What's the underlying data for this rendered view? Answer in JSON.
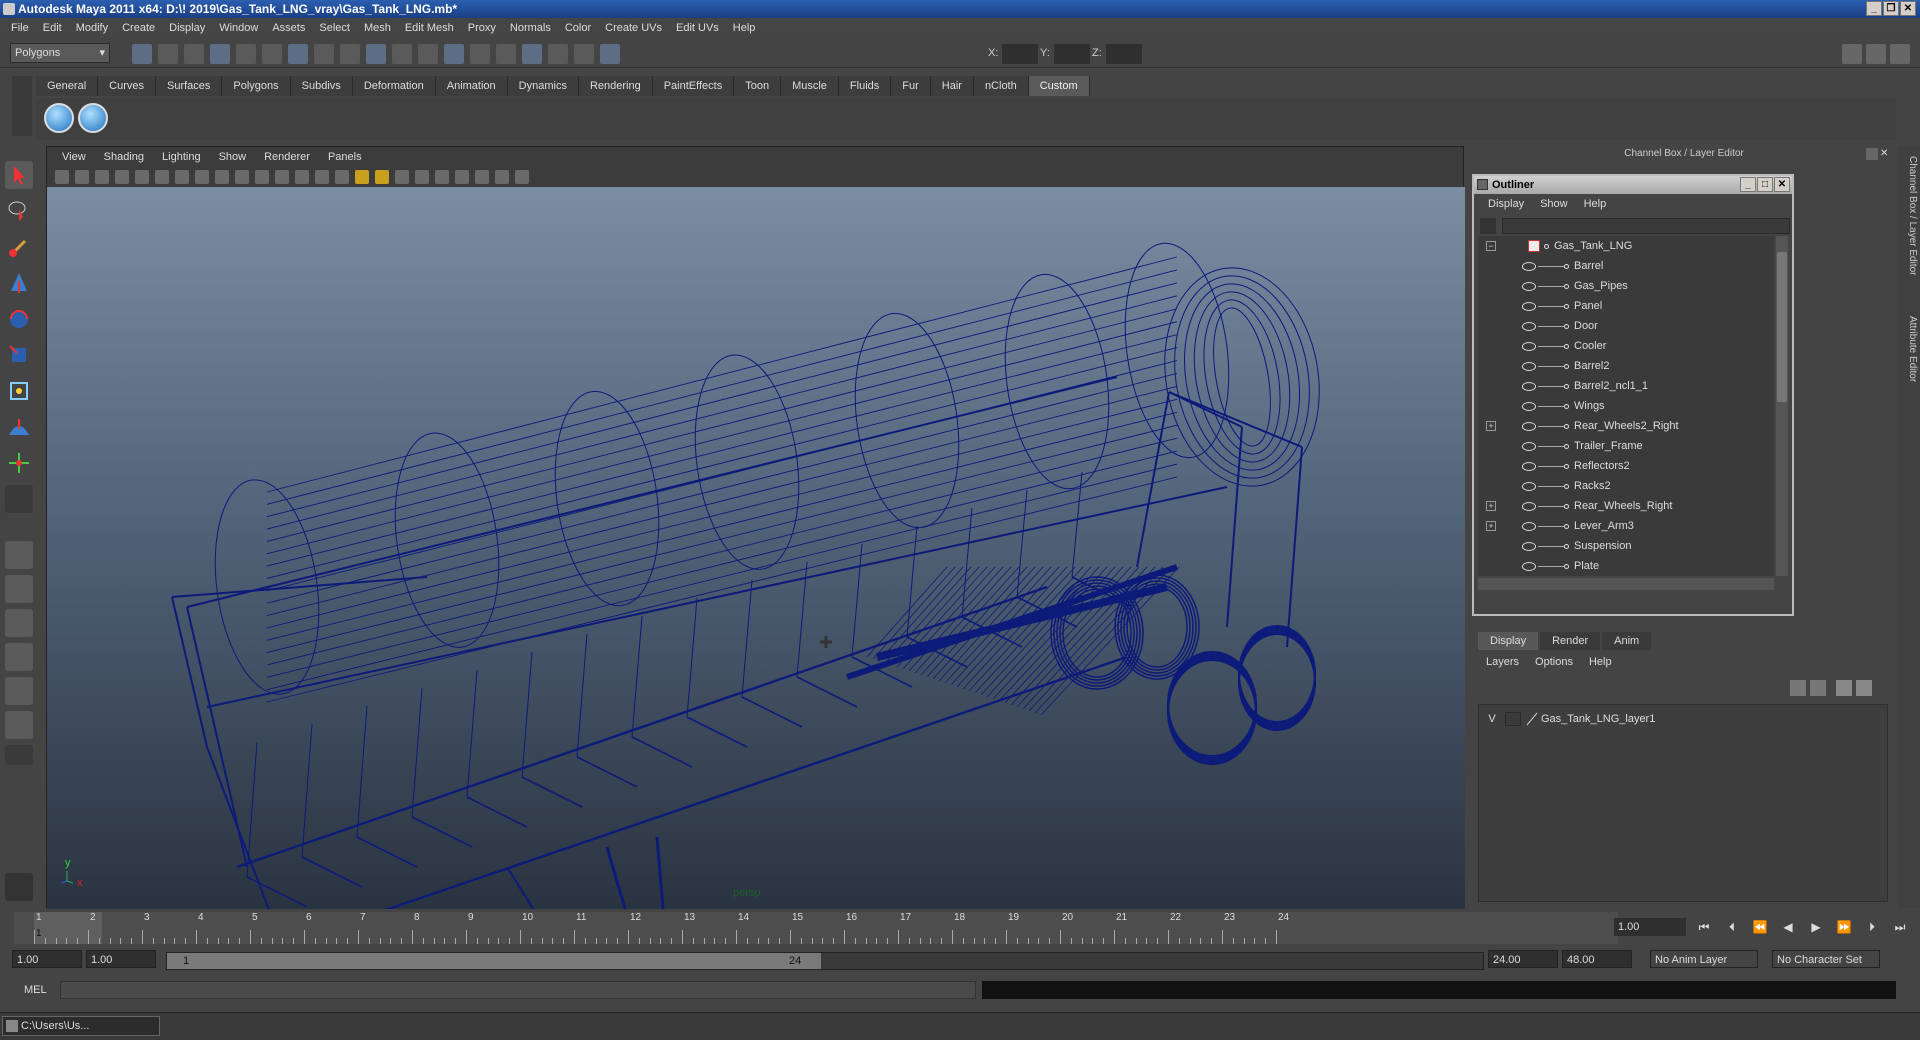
{
  "window": {
    "title": "Autodesk Maya 2011 x64: D:\\! 2019\\Gas_Tank_LNG_vray\\Gas_Tank_LNG.mb*"
  },
  "menubar": [
    "File",
    "Edit",
    "Modify",
    "Create",
    "Display",
    "Window",
    "Assets",
    "Select",
    "Mesh",
    "Edit Mesh",
    "Proxy",
    "Normals",
    "Color",
    "Create UVs",
    "Edit UVs",
    "Help"
  ],
  "statusline": {
    "mode_select": "Polygons",
    "x_label": "X:",
    "y_label": "Y:",
    "z_label": "Z:"
  },
  "shelf_tabs": [
    "General",
    "Curves",
    "Surfaces",
    "Polygons",
    "Subdivs",
    "Deformation",
    "Animation",
    "Dynamics",
    "Rendering",
    "PaintEffects",
    "Toon",
    "Muscle",
    "Fluids",
    "Fur",
    "Hair",
    "nCloth",
    "Custom"
  ],
  "shelf_active": "Custom",
  "viewport": {
    "menu": [
      "View",
      "Shading",
      "Lighting",
      "Show",
      "Renderer",
      "Panels"
    ],
    "camera_label": "persp",
    "axis_y": "y",
    "axis_x": "x"
  },
  "right_panel": {
    "title": "Channel Box / Layer Editor"
  },
  "outliner": {
    "title": "Outliner",
    "menu": [
      "Display",
      "Show",
      "Help"
    ],
    "root": "Gas_Tank_LNG",
    "items": [
      {
        "label": "Barrel",
        "expandable": false
      },
      {
        "label": "Gas_Pipes",
        "expandable": false
      },
      {
        "label": "Panel",
        "expandable": false
      },
      {
        "label": "Door",
        "expandable": false
      },
      {
        "label": "Cooler",
        "expandable": false
      },
      {
        "label": "Barrel2",
        "expandable": false
      },
      {
        "label": "Barrel2_ncl1_1",
        "expandable": false
      },
      {
        "label": "Wings",
        "expandable": false
      },
      {
        "label": "Rear_Wheels2_Right",
        "expandable": true
      },
      {
        "label": "Trailer_Frame",
        "expandable": false
      },
      {
        "label": "Reflectors2",
        "expandable": false
      },
      {
        "label": "Racks2",
        "expandable": false
      },
      {
        "label": "Rear_Wheels_Right",
        "expandable": true
      },
      {
        "label": "Lever_Arm3",
        "expandable": true
      },
      {
        "label": "Suspension",
        "expandable": false
      },
      {
        "label": "Plate",
        "expandable": false
      }
    ]
  },
  "layer_editor": {
    "tabs": [
      "Display",
      "Render",
      "Anim"
    ],
    "active_tab": "Display",
    "menu": [
      "Layers",
      "Options",
      "Help"
    ],
    "layers": [
      {
        "visible": "V",
        "name": "Gas_Tank_LNG_layer1"
      }
    ]
  },
  "side_tabs": [
    "Channel Box / Layer Editor",
    "Attribute Editor"
  ],
  "timeline": {
    "ticks": [
      "1",
      "2",
      "3",
      "4",
      "5",
      "6",
      "7",
      "8",
      "9",
      "10",
      "11",
      "12",
      "13",
      "14",
      "15",
      "16",
      "17",
      "18",
      "19",
      "20",
      "21",
      "22",
      "23",
      "24"
    ],
    "current_frame": "1.00",
    "cursor_label": "1"
  },
  "range": {
    "start_time": "1.00",
    "playback_start": "1.00",
    "slider_start": "1",
    "slider_end": "24",
    "playback_end": "24.00",
    "end_time": "48.00",
    "anim_layer": "No Anim Layer",
    "character_set": "No Character Set"
  },
  "mel": {
    "label": "MEL"
  },
  "taskbar": {
    "item": "C:\\Users\\Us..."
  },
  "colors": {
    "wireframe": "#0c1a7a",
    "viewport_top": "#7a8da3",
    "viewport_bottom": "#2a3340"
  }
}
